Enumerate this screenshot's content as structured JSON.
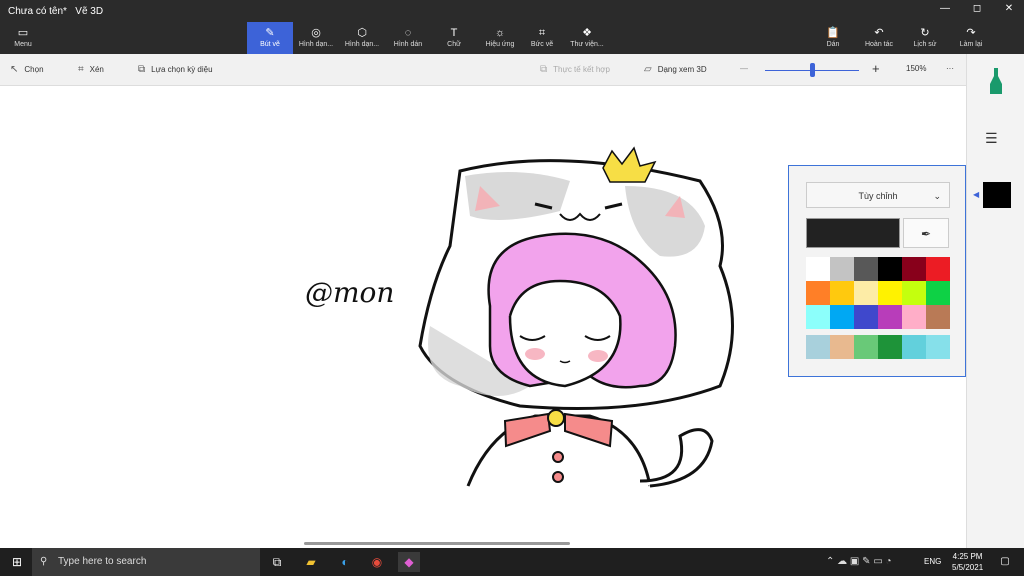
{
  "app": {
    "document_title": "Chưa có tên*",
    "app_name": "Vẽ 3D"
  },
  "window_controls": {
    "minimize": "—",
    "maximize": "◻",
    "close": "✕"
  },
  "ribbon": {
    "menu_label": "Menu",
    "items": [
      {
        "label": "Bút vẽ",
        "icon": "brush-icon"
      },
      {
        "label": "Hình dạn...",
        "icon": "2d-shapes-icon"
      },
      {
        "label": "Hình dạn...",
        "icon": "3d-shapes-icon"
      },
      {
        "label": "Hình dán",
        "icon": "stickers-icon"
      },
      {
        "label": "Chữ",
        "icon": "text-icon"
      },
      {
        "label": "Hiệu ứng",
        "icon": "effects-icon"
      },
      {
        "label": "Bức vẽ",
        "icon": "canvas-icon"
      },
      {
        "label": "Thư viện...",
        "icon": "3d-library-icon"
      }
    ],
    "right": [
      {
        "label": "Dán",
        "icon": "paste-icon"
      },
      {
        "label": "Hoàn tác",
        "icon": "undo-icon"
      },
      {
        "label": "Lịch sử",
        "icon": "history-icon"
      },
      {
        "label": "Làm lại",
        "icon": "redo-icon"
      }
    ]
  },
  "toolbar": {
    "select": "Chọn",
    "crop": "Xén",
    "magic_select": "Lựa chọn kỳ diệu",
    "mixed_reality": "Thực tế kết hợp",
    "view_3d": "Dạng xem 3D",
    "zoom": "150%",
    "more": "···",
    "zoom_minus": "—",
    "zoom_plus": "+"
  },
  "panel": {
    "dropdown": "Tùy chỉnh",
    "current_color": "#222222",
    "palette": [
      "#ffffff",
      "#c3c3c3",
      "#585858",
      "#000000",
      "#88001b",
      "#ec1c24",
      "#ff7f27",
      "#ffc90e",
      "#fdeca6",
      "#fff200",
      "#c4ff0e",
      "#0ed145",
      "#8cfffb",
      "#00a8f3",
      "#3f48cc",
      "#b83dba",
      "#ffaec8",
      "#b97a56",
      "#a8d0dc",
      "#e8b98f",
      "#69c978",
      "#1e9339",
      "#62d0dc",
      "#86e0ea"
    ]
  },
  "drawing": {
    "signature": "@mon"
  },
  "taskbar": {
    "search_placeholder": "Type here to search",
    "time": "4:25 PM",
    "date": "5/5/2021",
    "lang": "ENG"
  }
}
